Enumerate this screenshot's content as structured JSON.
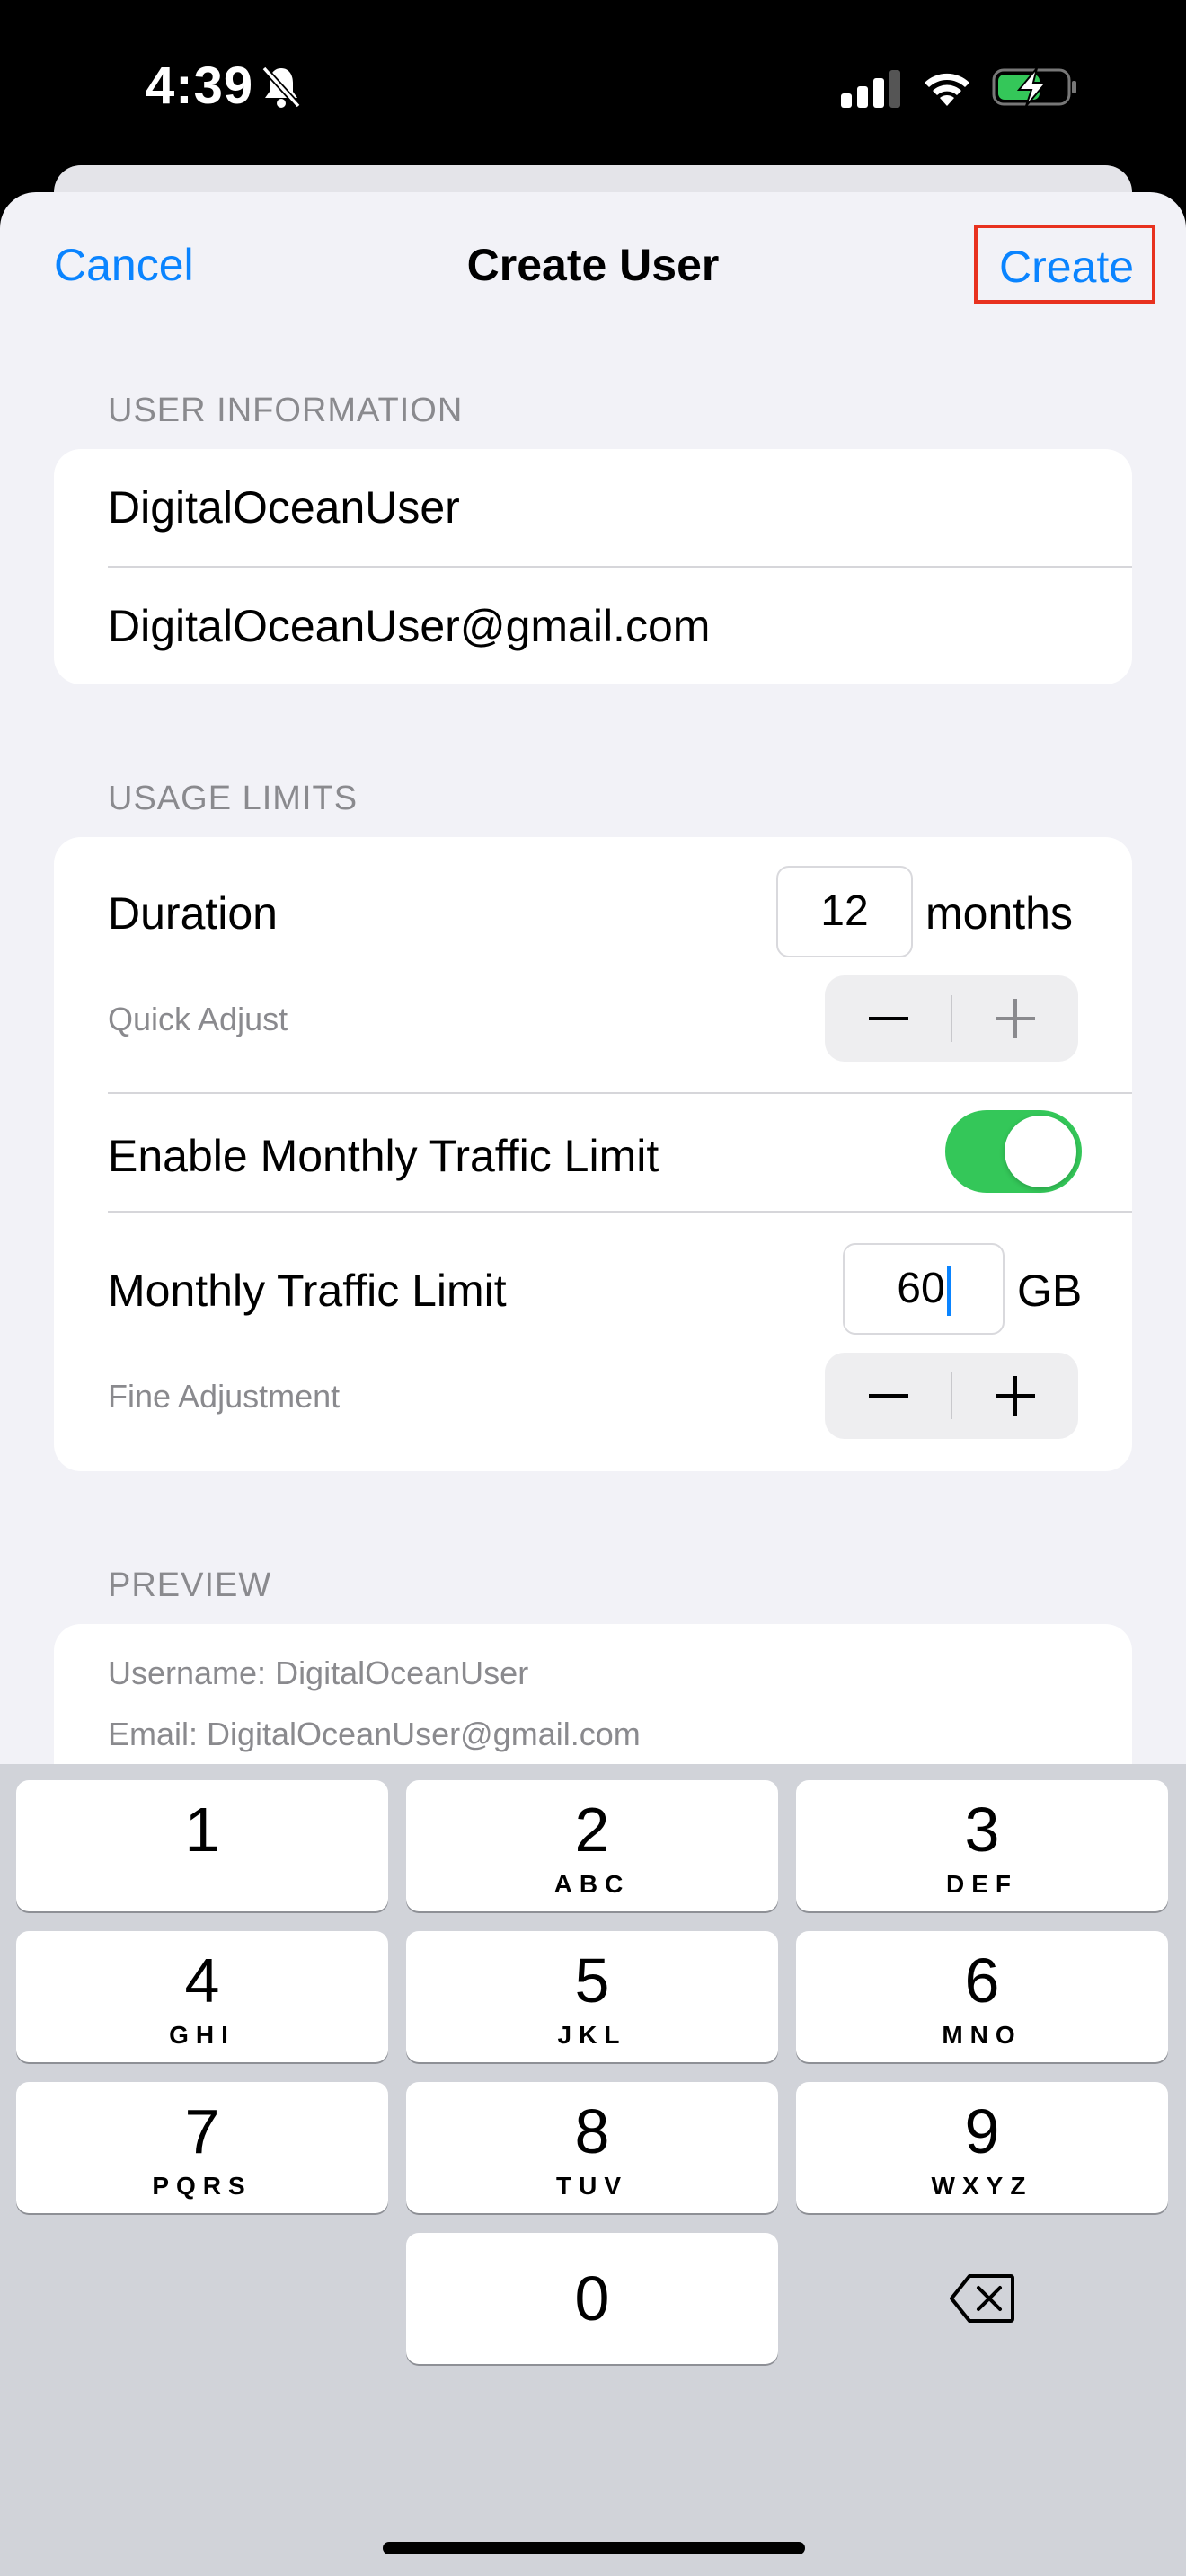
{
  "status_bar": {
    "time": "4:39"
  },
  "nav": {
    "cancel": "Cancel",
    "title": "Create User",
    "create": "Create"
  },
  "user_information": {
    "header": "USER INFORMATION",
    "username": "DigitalOceanUser",
    "email": "DigitalOceanUser@gmail.com"
  },
  "usage_limits": {
    "header": "USAGE LIMITS",
    "duration_label": "Duration",
    "duration_value": "12",
    "duration_unit": "months",
    "quick_adjust_label": "Quick Adjust",
    "enable_traffic_label": "Enable Monthly Traffic Limit",
    "enable_traffic_on": true,
    "traffic_label": "Monthly Traffic Limit",
    "traffic_value": "60",
    "traffic_unit": "GB",
    "fine_adjust_label": "Fine Adjustment"
  },
  "preview": {
    "header": "PREVIEW",
    "username_line": "Username: DigitalOceanUser",
    "email_line": "Email: DigitalOceanUser@gmail.com"
  },
  "keyboard": {
    "keys": [
      {
        "digit": "1",
        "letters": ""
      },
      {
        "digit": "2",
        "letters": "ABC"
      },
      {
        "digit": "3",
        "letters": "DEF"
      },
      {
        "digit": "4",
        "letters": "GHI"
      },
      {
        "digit": "5",
        "letters": "JKL"
      },
      {
        "digit": "6",
        "letters": "MNO"
      },
      {
        "digit": "7",
        "letters": "PQRS"
      },
      {
        "digit": "8",
        "letters": "TUV"
      },
      {
        "digit": "9",
        "letters": "WXYZ"
      },
      {
        "digit": "0",
        "letters": ""
      }
    ]
  },
  "colors": {
    "accent": "#0a84ff",
    "toggle_on": "#34c759",
    "highlight_box": "#e8321f"
  }
}
